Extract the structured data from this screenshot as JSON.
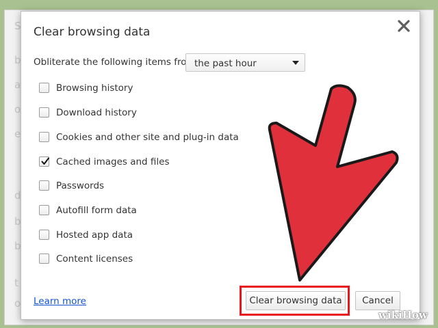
{
  "dialog": {
    "title": "Clear browsing data",
    "range_label": "Obliterate the following items from:",
    "range_value": "the past hour",
    "items": [
      {
        "label": "Browsing history",
        "checked": false
      },
      {
        "label": "Download history",
        "checked": false
      },
      {
        "label": "Cookies and other site and plug-in data",
        "checked": false
      },
      {
        "label": "Cached images and files",
        "checked": true
      },
      {
        "label": "Passwords",
        "checked": false
      },
      {
        "label": "Autofill form data",
        "checked": false
      },
      {
        "label": "Hosted app data",
        "checked": false
      },
      {
        "label": "Content licenses",
        "checked": false
      }
    ],
    "learn_more": "Learn more",
    "clear_button": "Clear browsing data",
    "cancel_button": "Cancel"
  },
  "annotation": {
    "arrow_color": "#e0303b",
    "highlight_color": "#e8161b"
  },
  "watermark": "wikiHow",
  "colors": {
    "background": "#a9c190",
    "link": "#1155cc"
  }
}
